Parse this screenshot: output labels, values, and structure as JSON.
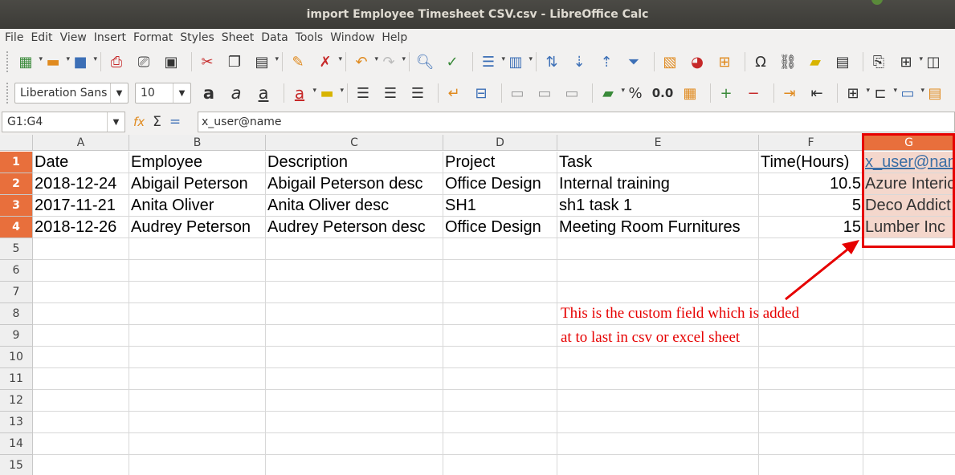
{
  "window": {
    "title": "import Employee Timesheet CSV.csv - LibreOffice Calc"
  },
  "menu": [
    "File",
    "Edit",
    "View",
    "Insert",
    "Format",
    "Styles",
    "Sheet",
    "Data",
    "Tools",
    "Window",
    "Help"
  ],
  "toolbar": {
    "font_name": "Liberation Sans",
    "font_size": "10"
  },
  "formula_bar": {
    "cell_ref": "G1:G4",
    "value": "x_user@name"
  },
  "columns": [
    "A",
    "B",
    "C",
    "D",
    "E",
    "F",
    "G"
  ],
  "rows": [
    "1",
    "2",
    "3",
    "4",
    "5",
    "6",
    "7",
    "8",
    "9",
    "10",
    "11",
    "12",
    "13",
    "14",
    "15"
  ],
  "cells": {
    "r1": [
      "Date",
      "Employee",
      "Description",
      "Project",
      "Task",
      "Time(Hours)",
      "x_user@name"
    ],
    "r2": [
      "2018-12-24",
      "Abigail Peterson",
      "Abigail Peterson desc",
      "Office Design",
      "Internal training",
      "10.5",
      "Azure Interior"
    ],
    "r3": [
      "2017-11-21",
      "Anita Oliver",
      "Anita Oliver desc",
      "SH1",
      "sh1 task 1",
      "5",
      "Deco Addict"
    ],
    "r4": [
      "2018-12-26",
      "Audrey Peterson",
      "Audrey Peterson desc",
      "Office Design",
      "Meeting Room Furnitures",
      "15",
      "Lumber Inc"
    ]
  },
  "annotation": {
    "line1": "This is the custom field which is added",
    "line2": "at to last in csv or excel sheet",
    "color": "#e60000"
  },
  "accent": {
    "selection": "#e86f3c"
  }
}
